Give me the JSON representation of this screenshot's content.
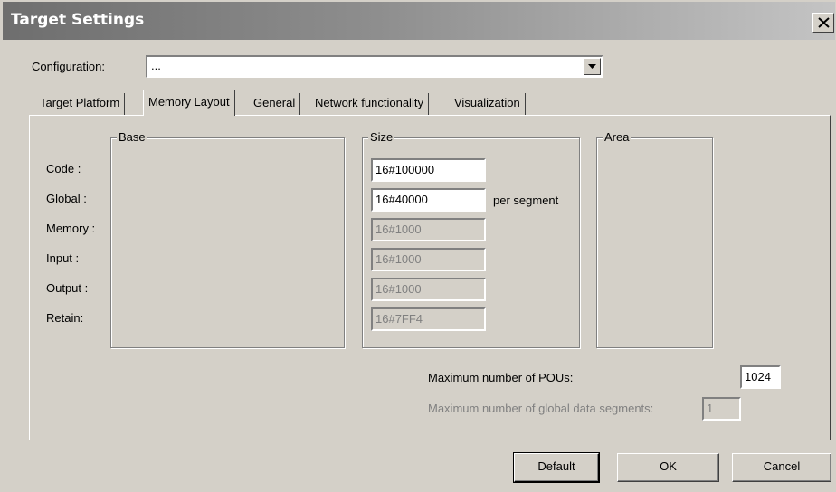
{
  "window": {
    "title": "Target Settings"
  },
  "config": {
    "label": "Configuration:",
    "value": "..."
  },
  "tabs": [
    {
      "label": "Target Platform"
    },
    {
      "label": "Memory Layout"
    },
    {
      "label": "General"
    },
    {
      "label": "Network functionality"
    },
    {
      "label": "Visualization"
    }
  ],
  "groups": {
    "base": "Base",
    "size": "Size",
    "area": "Area"
  },
  "rows": [
    {
      "label": "Code :",
      "size": "16#100000",
      "enabled": true
    },
    {
      "label": "Global :",
      "size": "16#40000",
      "enabled": true,
      "suffix": "per segment"
    },
    {
      "label": "Memory :",
      "size": "16#1000",
      "enabled": false
    },
    {
      "label": "Input :",
      "size": "16#1000",
      "enabled": false
    },
    {
      "label": "Output :",
      "size": "16#1000",
      "enabled": false
    },
    {
      "label": "Retain:",
      "size": "16#7FF4",
      "enabled": false
    }
  ],
  "max_pous": {
    "label": "Maximum number of POUs:",
    "value": "1024"
  },
  "max_segments": {
    "label": "Maximum number of global data segments:",
    "value": "1"
  },
  "buttons": {
    "default": "Default",
    "ok": "OK",
    "cancel": "Cancel"
  },
  "colors": {
    "face": "#d4d0c8",
    "titlebar": "#6e6e6e",
    "disabled_text": "#808080"
  },
  "icons": {
    "close": "close-icon",
    "dropdown": "chevron-down-icon"
  }
}
